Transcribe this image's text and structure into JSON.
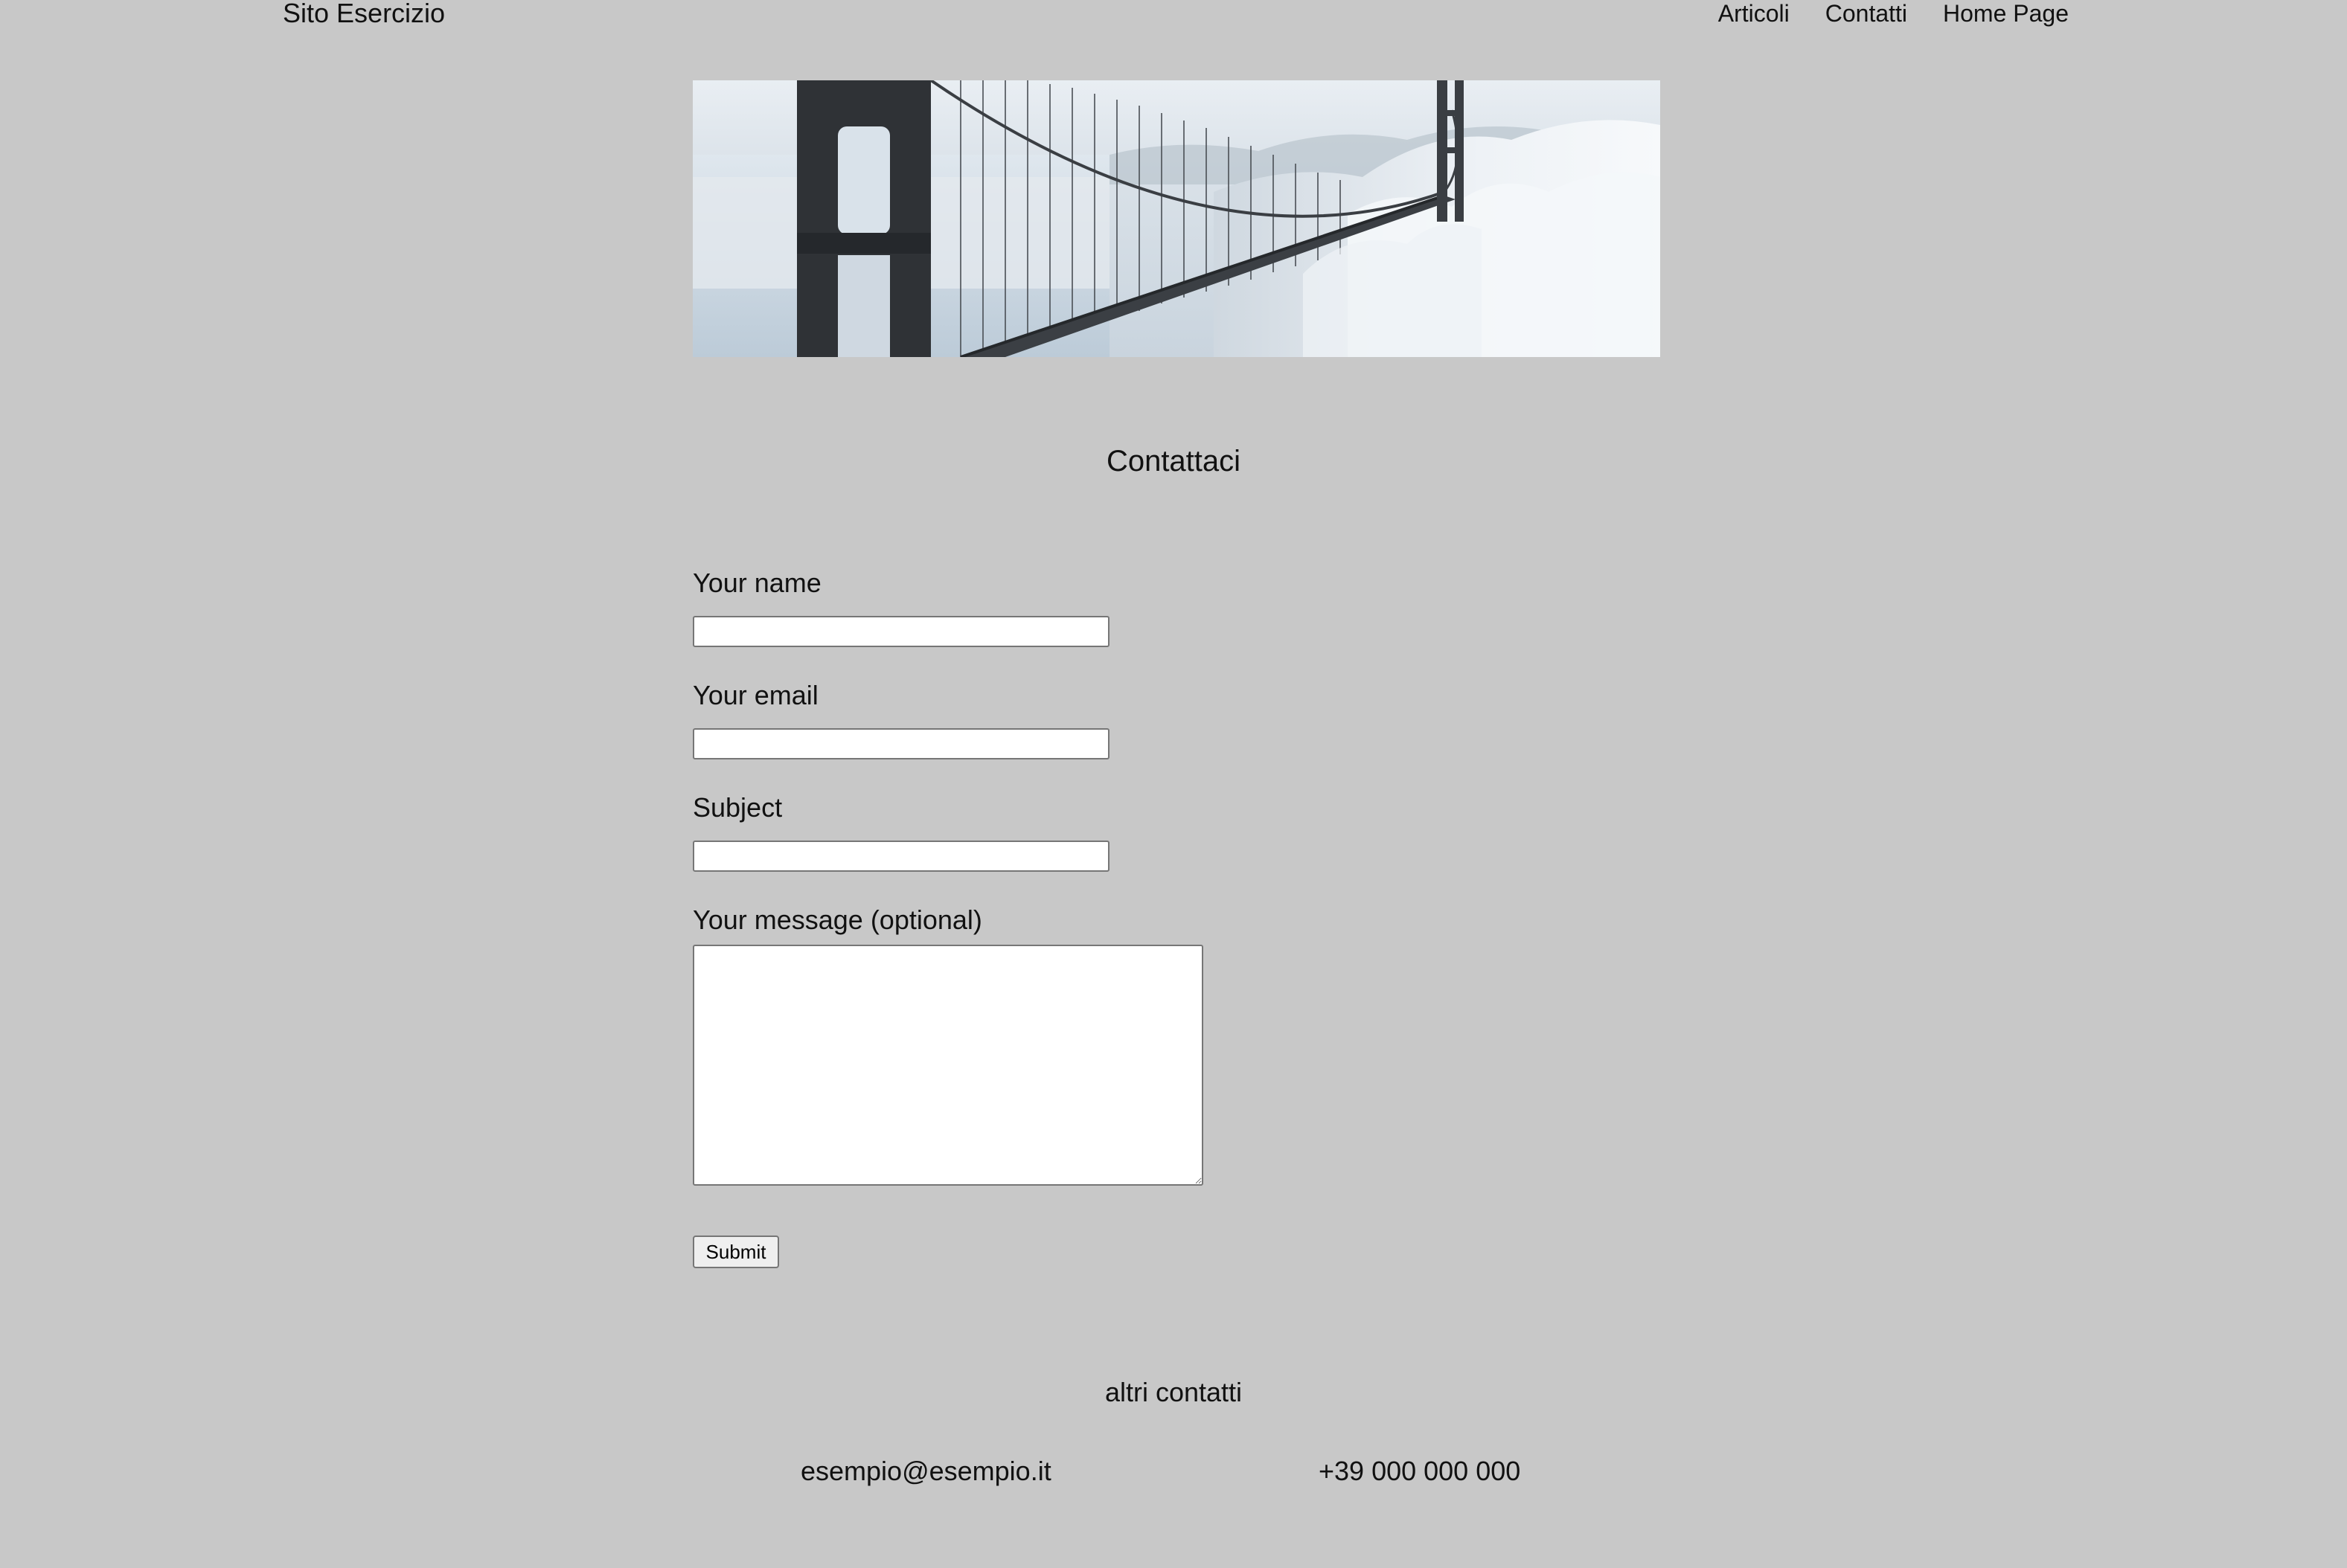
{
  "header": {
    "site_title": "Sito Esercizio",
    "nav": [
      {
        "label": "Articoli"
      },
      {
        "label": "Contatti"
      },
      {
        "label": "Home Page"
      }
    ]
  },
  "banner": {
    "subject": "bridge in fog photo"
  },
  "page": {
    "heading": "Contattaci"
  },
  "form": {
    "name_label": "Your name",
    "name_value": "",
    "email_label": "Your email",
    "email_value": "",
    "subject_label": "Subject",
    "subject_value": "",
    "message_label": "Your message (optional)",
    "message_value": "",
    "submit_label": "Submit"
  },
  "footer": {
    "heading": "altri contatti",
    "email": "esempio@esempio.it",
    "phone": "+39 000 000 000"
  },
  "colors": {
    "background": "#c8c8c8",
    "text": "#111111",
    "input_border": "#767676"
  }
}
